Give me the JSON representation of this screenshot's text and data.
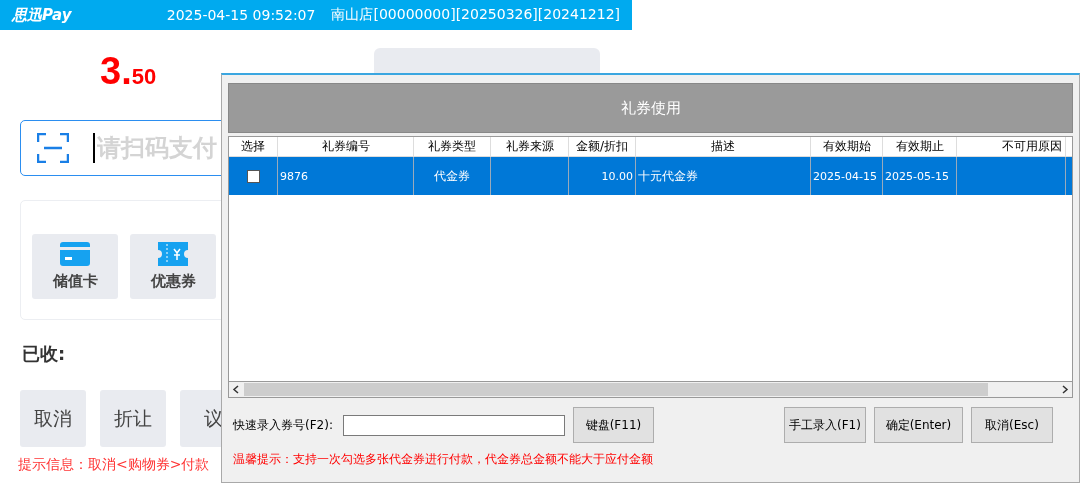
{
  "header": {
    "brand": "思迅Pay",
    "datetime": "2025-04-15 09:52:07",
    "store": "南山店[00000000][20250326][20241212]"
  },
  "amount": {
    "main": "3.",
    "fraction": "50"
  },
  "scan_field": {
    "placeholder": "请扫码支付"
  },
  "payment_methods": [
    {
      "label": "储值卡",
      "kind": "card"
    },
    {
      "label": "优惠券",
      "kind": "coupon"
    }
  ],
  "received_label": "已收:",
  "actions": [
    "取消",
    "折让",
    "议"
  ],
  "hint": "提示信息：取消<购物券>付款",
  "dialog": {
    "title": "礼券使用",
    "table": {
      "columns": [
        "选择",
        "礼券编号",
        "礼券类型",
        "礼券来源",
        "金额/折扣",
        "描述",
        "有效期始",
        "有效期止",
        "不可用原因"
      ],
      "rows": [
        {
          "selected": true,
          "checked": false,
          "cells": [
            "",
            "9876",
            "代金券",
            "",
            "10.00",
            "十元代金券",
            "2025-04-15",
            "2025-05-15",
            ""
          ]
        }
      ]
    },
    "quick_entry": {
      "label": "快速录入券号(F2):"
    },
    "keyboard_button": "键盘(F11)",
    "buttons": [
      "手工录入(F1)",
      "确定(Enter)",
      "取消(Esc)"
    ],
    "tip": "温馨提示：支持一次勾选多张代金券进行付款，代金券总金额不能大于应付金额"
  }
}
